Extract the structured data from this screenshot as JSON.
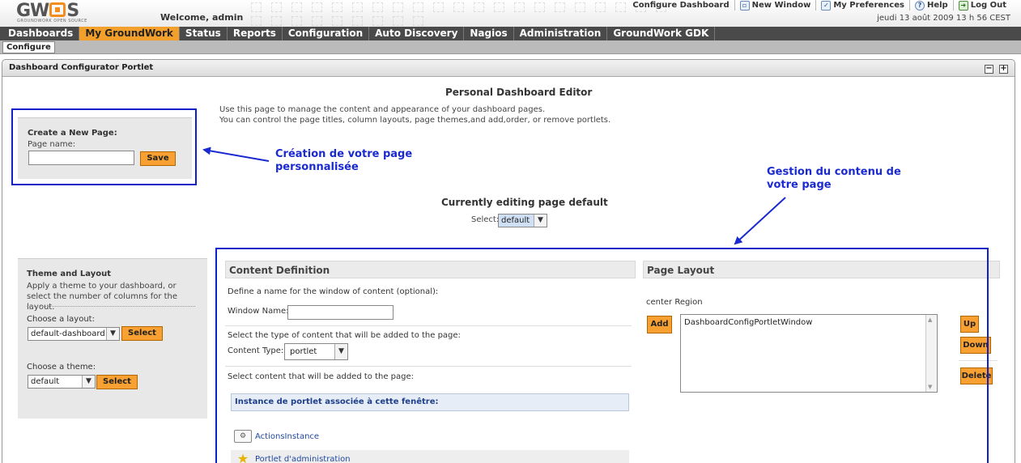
{
  "header": {
    "logo_main": "GW",
    "logo_end": "S",
    "logo_tagline": "GROUNDWORK OPEN SOURCE",
    "welcome": "Welcome, admin",
    "links": [
      {
        "label": "Configure Dashboard",
        "icon": "dashboard-icon"
      },
      {
        "label": "New Window",
        "icon": "new-window-icon"
      },
      {
        "label": "My Preferences",
        "icon": "preferences-icon"
      },
      {
        "label": "Help",
        "icon": "help-icon"
      },
      {
        "label": "Log Out",
        "icon": "logout-icon"
      }
    ],
    "datetime": "jeudi 13 août 2009 13 h 56 CEST"
  },
  "nav": {
    "items": [
      "Dashboards",
      "My GroundWork",
      "Status",
      "Reports",
      "Configuration",
      "Auto Discovery",
      "Nagios",
      "Administration",
      "GroundWork GDK"
    ],
    "active": "My GroundWork",
    "sub_items": [
      "Configure"
    ]
  },
  "portlet": {
    "title": "Dashboard Configurator Portlet",
    "minimize_symbol": "−",
    "maximize_symbol": "+"
  },
  "editor": {
    "title": "Personal Dashboard Editor",
    "intro_line1": "Use this page to manage the content and appearance of your dashboard pages.",
    "intro_line2": "You can control the page titles, column layouts, page themes,and add,order, or remove portlets."
  },
  "create_page": {
    "label": "Create a New Page:",
    "page_name_label": "Page name:",
    "page_name_value": "",
    "save_label": "Save"
  },
  "annotations": {
    "create_line1": "Création de votre page",
    "create_line2": "personnalisée",
    "manage_line1": "Gestion du contenu de",
    "manage_line2": "votre page"
  },
  "editing": {
    "title": "Currently editing page default",
    "select_label": "Select:",
    "select_value": "default"
  },
  "theme_layout": {
    "title": "Theme and Layout",
    "description": "Apply a theme to your dashboard, or select the number of columns for the layout.",
    "layout_label": "Choose a layout:",
    "layout_value": "default-dashboard",
    "theme_label": "Choose a theme:",
    "theme_value": "default",
    "select_label": "Select"
  },
  "content_definition": {
    "title": "Content Definition",
    "define_text": "Define a name for the window of content (optional):",
    "window_name_label": "Window Name:",
    "window_name_value": "",
    "type_text": "Select the type of content that will be added to the page:",
    "content_type_label": "Content Type:",
    "content_type_value": "portlet",
    "select_content_text": "Select content that will be added to the page:",
    "instance_header": "Instance de portlet associée à cette fenêtre:",
    "instances": [
      {
        "label": "ActionsInstance",
        "icon": "portlet-icon"
      },
      {
        "label": "Portlet d'administration",
        "icon": "star-icon"
      }
    ]
  },
  "page_layout": {
    "title": "Page Layout",
    "region_label": "center Region",
    "add_label": "Add",
    "windows": [
      "DashboardConfigPortletWindow"
    ],
    "up_label": "Up",
    "down_label": "Down",
    "delete_label": "Delete"
  },
  "colors": {
    "accent_orange": "#f8a032",
    "nav_bg": "#4a4a4a",
    "annotation_blue": "#1a2ad0"
  }
}
